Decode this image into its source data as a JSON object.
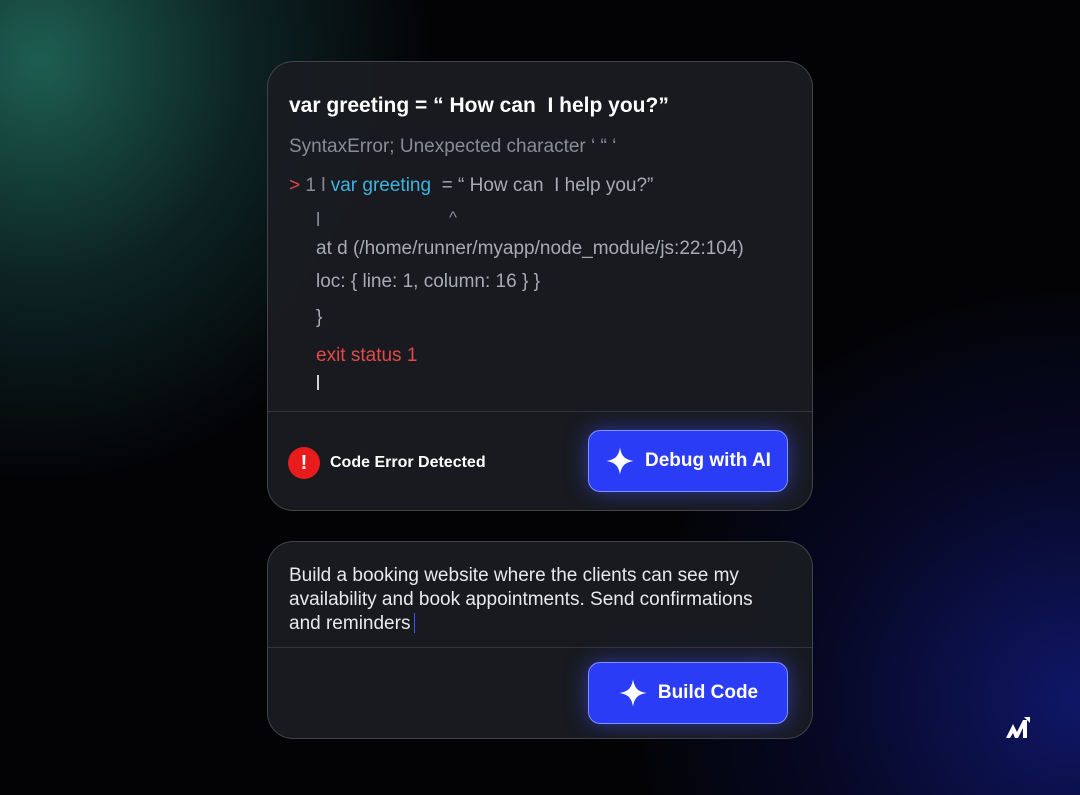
{
  "error_card": {
    "title": "var greeting = “ How can  I help you?”",
    "error_message": "SyntaxError; Unexpected character ‘ “ ‘",
    "prompt_arrow": ">",
    "line_gutter": " 1 l ",
    "line_keyword": "var greeting",
    "line_rest": "  = “ How can  I help you?”",
    "pipe_marker": "l",
    "caret_marker": "^",
    "stack_at": "at d (/home/runner/myapp/node_module/js:22:104)",
    "loc_line": "loc: { line: 1, column: 16 } }",
    "closing_brace": "}",
    "exit_status": "exit status 1",
    "status_icon": "exclamation-icon",
    "status_label": "Code Error Detected",
    "debug_button_label": "Debug with AI",
    "button_icon": "sparkle-icon"
  },
  "prompt_card": {
    "prompt_text": "Build a booking website where the clients can see my availability and book appointments. Send confirmations and reminders",
    "build_button_label": "Build Code",
    "button_icon": "sparkle-icon"
  },
  "brand": {
    "logo_icon": "brand-logo-icon"
  },
  "colors": {
    "accent": "#2a3cf5",
    "error": "#e24a4a",
    "keyword": "#3fb3e0",
    "error_badge": "#e81c1c"
  }
}
